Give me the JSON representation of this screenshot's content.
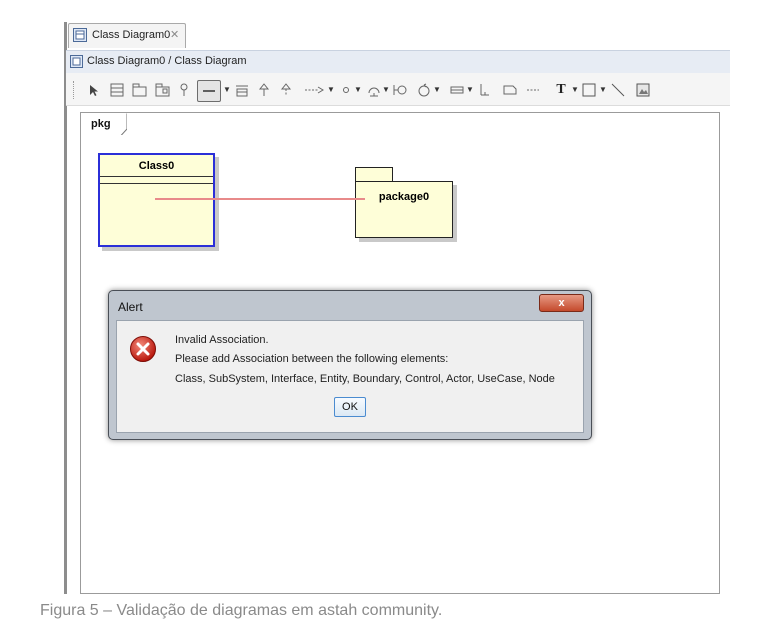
{
  "tab": {
    "label": "Class Diagram0",
    "close": "✕"
  },
  "breadcrumb": {
    "path": "Class Diagram0 / Class Diagram"
  },
  "toolbar": {
    "text_tool": "T"
  },
  "diagram": {
    "frame_label": "pkg",
    "class_name": "Class0",
    "package_name": "package0",
    "association_color": "#e88a8a"
  },
  "alert": {
    "title": "Alert",
    "close_label": "x",
    "line1": "Invalid Association.",
    "line2": "Please add Association between the following elements:",
    "line3": "Class, SubSystem, Interface, Entity, Boundary, Control, Actor, UseCase, Node",
    "ok_label": "OK"
  },
  "caption": "Figura 5 – Validação de diagramas em astah community."
}
